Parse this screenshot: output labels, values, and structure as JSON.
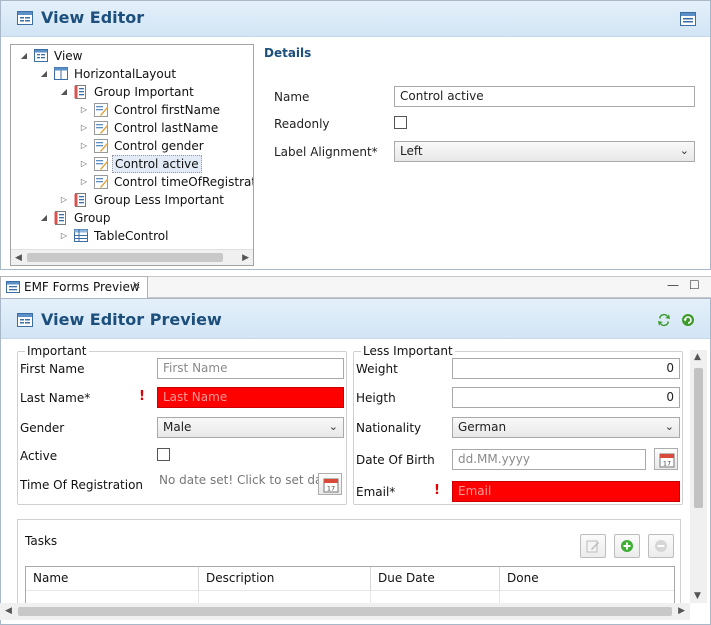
{
  "editor": {
    "title": "View Editor",
    "icon": "view-editor-icon"
  },
  "tree": {
    "nodes": [
      {
        "label": "View",
        "icon": "view-icon",
        "expanded": true
      },
      {
        "label": "HorizontalLayout",
        "icon": "layout-icon",
        "expanded": true
      },
      {
        "label": "Group Important",
        "icon": "group-icon",
        "expanded": true
      },
      {
        "label": "Control firstName",
        "icon": "control-icon"
      },
      {
        "label": "Control lastName",
        "icon": "control-icon"
      },
      {
        "label": "Control gender",
        "icon": "control-icon"
      },
      {
        "label": "Control active",
        "icon": "control-icon",
        "selected": true
      },
      {
        "label": "Control timeOfRegistration",
        "icon": "control-icon"
      },
      {
        "label": "Group Less Important",
        "icon": "group-icon"
      },
      {
        "label": "Group",
        "icon": "group-icon",
        "expanded": true
      },
      {
        "label": "TableControl",
        "icon": "table-icon"
      }
    ]
  },
  "details": {
    "title": "Details",
    "name_label": "Name",
    "name_value": "Control active",
    "readonly_label": "Readonly",
    "readonly_checked": false,
    "label_alignment_label": "Label Alignment*",
    "label_alignment_value": "Left"
  },
  "preview_tab": {
    "label": "EMF Forms Preview"
  },
  "preview": {
    "title": "View Editor Preview",
    "important": {
      "title": "Important",
      "first_name_label": "First Name",
      "first_name_placeholder": "First Name",
      "last_name_label": "Last Name*",
      "last_name_placeholder": "Last Name",
      "gender_label": "Gender",
      "gender_value": "Male",
      "active_label": "Active",
      "active_checked": false,
      "registration_label": "Time Of Registration",
      "registration_hint": "No date set! Click to set date."
    },
    "less_important": {
      "title": "Less Important",
      "weight_label": "Weight",
      "weight_value": "0",
      "height_label": "Heigth",
      "height_value": "0",
      "nationality_label": "Nationality",
      "nationality_value": "German",
      "dob_label": "Date Of Birth",
      "dob_placeholder": "dd.MM.yyyy",
      "email_label": "Email*",
      "email_placeholder": "Email"
    },
    "tasks": {
      "title": "Tasks",
      "columns": [
        "Name",
        "Description",
        "Due Date",
        "Done"
      ]
    }
  },
  "colors": {
    "header_title": "#1d4f7c",
    "header_bg": "#d8e8f6",
    "error": "#ff0000"
  }
}
